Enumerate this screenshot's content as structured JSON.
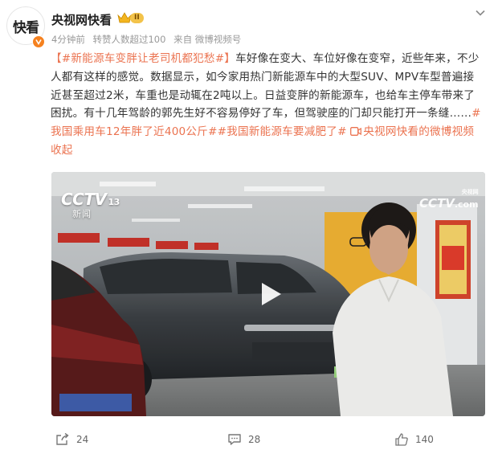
{
  "post": {
    "avatar_text": "快看",
    "username": "央视网快看",
    "level_badge": "II",
    "time": "4分钟前",
    "reposts_summary": "转赞人数超过100",
    "source": "来自 微博视频号",
    "hashtag_main": "【#新能源车变胖让老司机都犯愁#】",
    "body": "车好像在变大、车位好像在变窄，近些年来，不少人都有这样的感觉。数据显示，如今家用热门新能源车中的大型SUV、MPV车型普遍接近甚至超过2米，车重也是动辄在2吨以上。日益变胖的新能源车，也给车主停车带来了困扰。有十几年驾龄的郭先生好不容易停好了车，但驾驶座的门却只能打开一条缝……",
    "hashtag_2": "#我国乘用车12年胖了近400公斤#",
    "hashtag_3": "#我国新能源车要减肥了#",
    "video_link": "央视网快看的微博视频",
    "collapse": "收起"
  },
  "video": {
    "channel_logo": "CCTV",
    "channel_number": "13",
    "channel_name": "新闻",
    "watermark_brand": "CCTV",
    "watermark_cn": "央视网",
    "watermark_com": ".com"
  },
  "footer": {
    "repost_count": "24",
    "comment_count": "28",
    "like_count": "140"
  },
  "colors": {
    "accent": "#eb7350",
    "meta_gray": "#999999",
    "verified_orange": "#f5811f"
  }
}
